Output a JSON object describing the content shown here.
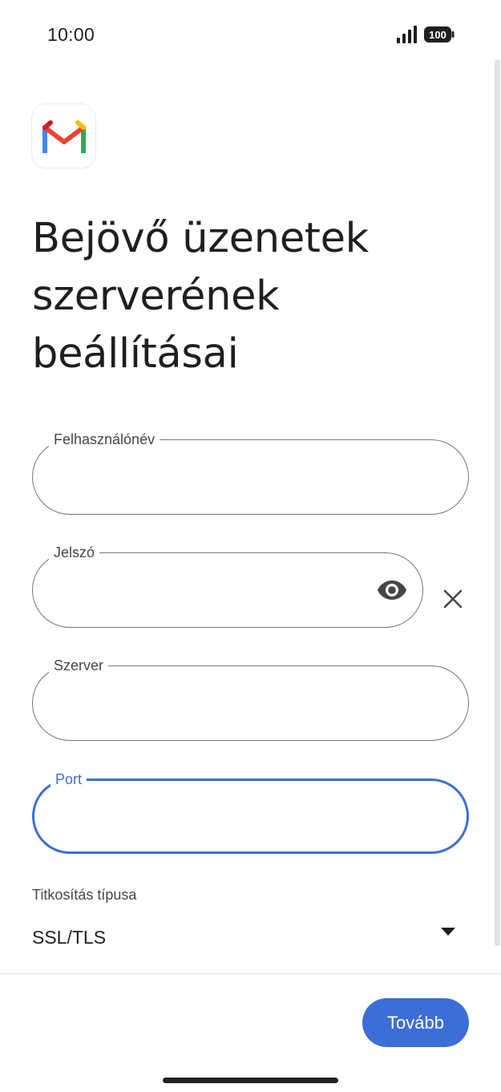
{
  "status_bar": {
    "time": "10:00",
    "battery": "100"
  },
  "page": {
    "title": "Bejövő üzenetek szerverének beállításai"
  },
  "form": {
    "username": {
      "label": "Felhasználónév",
      "value": ""
    },
    "password": {
      "label": "Jelszó",
      "value": ""
    },
    "server": {
      "label": "Szerver",
      "value": ""
    },
    "port": {
      "label": "Port",
      "value": ""
    }
  },
  "encryption": {
    "label": "Titkosítás típusa",
    "value": "SSL/TLS"
  },
  "footer": {
    "next_label": "Tovább"
  },
  "colors": {
    "accent": "#3c6ed6",
    "outline": "#747775",
    "text": "#1f1f1f"
  },
  "icons": [
    "gmail-logo-icon",
    "eye-icon",
    "close-icon",
    "dropdown-arrow-icon",
    "signal-icon",
    "battery-icon"
  ]
}
